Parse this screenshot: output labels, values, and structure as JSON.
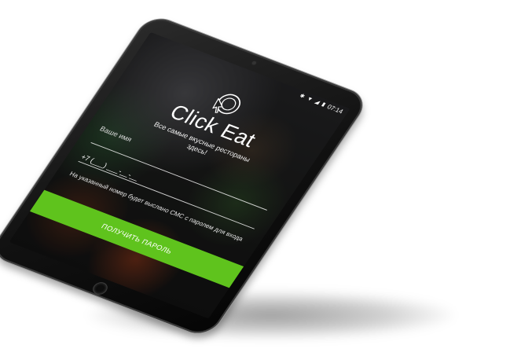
{
  "status_bar": {
    "time": "07:14",
    "icons": [
      "bluetooth-icon",
      "wifi-icon",
      "signal-icon",
      "battery-icon"
    ]
  },
  "app": {
    "name": "Click Eat",
    "tagline": "Все самые вкусные рестораны здесь!",
    "logo": "cursor-target-icon"
  },
  "form": {
    "name_label": "Ваше имя",
    "name_value": "",
    "phone_value": "+7 (___) ___-__-__",
    "hint": "На указанный номер будет выслано СМС с паролем для входа",
    "submit_label": "ПОЛУЧИТЬ ПАРОЛЬ"
  },
  "colors": {
    "accent": "#5fc31d",
    "device_frame": "#111111"
  }
}
